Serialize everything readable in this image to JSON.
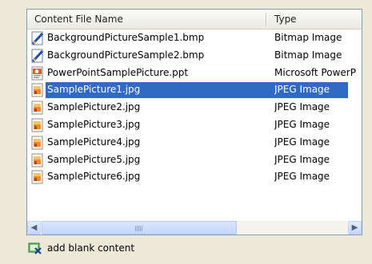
{
  "list": {
    "columns": {
      "name": "Content File Name",
      "type": "Type"
    },
    "items": [
      {
        "name": "BackgroundPictureSample1.bmp",
        "type": "Bitmap Image",
        "icon": "bitmap-file-icon"
      },
      {
        "name": "BackgroundPictureSample2.bmp",
        "type": "Bitmap Image",
        "icon": "bitmap-file-icon"
      },
      {
        "name": "PowerPointSamplePicture.ppt",
        "type": "Microsoft PowerP",
        "icon": "powerpoint-file-icon"
      },
      {
        "name": "SamplePicture1.jpg",
        "type": "JPEG Image",
        "icon": "jpeg-file-icon",
        "selected": true
      },
      {
        "name": "SamplePicture2.jpg",
        "type": "JPEG Image",
        "icon": "jpeg-file-icon"
      },
      {
        "name": "SamplePicture3.jpg",
        "type": "JPEG Image",
        "icon": "jpeg-file-icon"
      },
      {
        "name": "SamplePicture4.jpg",
        "type": "JPEG Image",
        "icon": "jpeg-file-icon"
      },
      {
        "name": "SamplePicture5.jpg",
        "type": "JPEG Image",
        "icon": "jpeg-file-icon"
      },
      {
        "name": "SamplePicture6.jpg",
        "type": "JPEG Image",
        "icon": "jpeg-file-icon"
      }
    ],
    "selection_color": "#316ac5"
  },
  "scrollbar": {
    "left_icon": "arrow-left-icon",
    "right_icon": "arrow-right-icon"
  },
  "add_blank": {
    "label": "add blank content",
    "icon": "add-blank-content-icon"
  }
}
